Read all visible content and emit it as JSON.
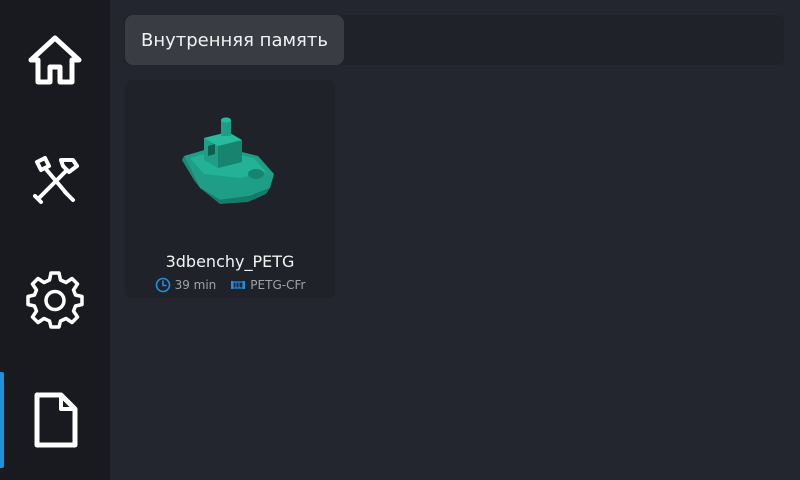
{
  "sidebar": {
    "items": [
      {
        "id": "home",
        "icon": "home-icon"
      },
      {
        "id": "tools",
        "icon": "tools-icon"
      },
      {
        "id": "settings",
        "icon": "gear-icon"
      },
      {
        "id": "files",
        "icon": "file-icon",
        "active": true
      }
    ],
    "accent": "#1e90e0"
  },
  "header": {
    "storage_label": "Внутренняя память"
  },
  "files": [
    {
      "name": "3dbenchy_PETG",
      "time": "39 min",
      "material": "PETG-CFr",
      "thumbnail_color": "#1e9e86"
    }
  ]
}
